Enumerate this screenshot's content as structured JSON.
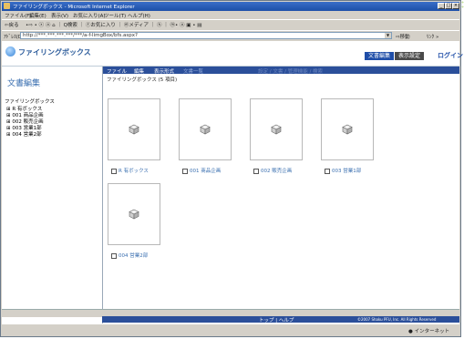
{
  "window": {
    "title": "ファイリングボックス - Microsoft Internet Explorer",
    "controls": [
      "_",
      "□",
      "×"
    ]
  },
  "menubar": [
    "ファイル(F)",
    "編集(E)",
    "表示(V)",
    "お気に入り(A)",
    "ツール(T)",
    "ヘルプ(H)"
  ],
  "toolbar": {
    "back": "⇦戻る",
    "items": "•⇨ • ⓧ ⓐ ⌂ ｜ Q検索 ｜ ⓕお気に入り ｜ ⓜメディア ｜ ⓗ ｜ ⓜ• ⓐ ▣ • ▤"
  },
  "address": {
    "label": "ｱﾄﾞﾚｽ(D)",
    "value": "http://***.***.***.***/***/a-f-limgBox/bfs.aspx?",
    "go": "⇨移動",
    "links": "ﾘﾝｸ »"
  },
  "app": {
    "title": "ファイリングボックス",
    "btn_edit": "文書編集",
    "btn_view": "表示設定",
    "btn_logout": "ログイン"
  },
  "leftpane": {
    "title": "文書編集",
    "tree": [
      {
        "label": "ファイリングボックス",
        "indent": 0
      },
      {
        "label": "⊞ R 有ボックス",
        "indent": 1
      },
      {
        "label": "⊞ 001 商品企画",
        "indent": 1
      },
      {
        "label": "⊞ 002 販売企画",
        "indent": 1
      },
      {
        "label": "⊞ 003 営業1部",
        "indent": 1
      },
      {
        "label": "⊞ 004 営業2部",
        "indent": 1
      }
    ]
  },
  "mainnav": {
    "file": "ファイル",
    "edit": "編集",
    "display": "表示形式",
    "tag": "文書一覧",
    "faded": "設定 / 文書 / 管理機能 / 検索"
  },
  "breadcrumb": "ファイリングボックス (5 項目)",
  "folders": [
    {
      "label": "R 有ボックス"
    },
    {
      "label": "001 商品企画"
    },
    {
      "label": "002 販売企画"
    },
    {
      "label": "003 営業1部"
    },
    {
      "label": "004 営業2部"
    }
  ],
  "footer": {
    "center": "トップ | ヘルプ",
    "right": "©2007 Shaku PFU, Inc. All Rights Reserved"
  },
  "status": {
    "zone": "インターネット"
  },
  "colors": {
    "accent": "#1f4ea8",
    "title_text": "#3a6fb0",
    "nav_bg": "#2b4f9a"
  }
}
